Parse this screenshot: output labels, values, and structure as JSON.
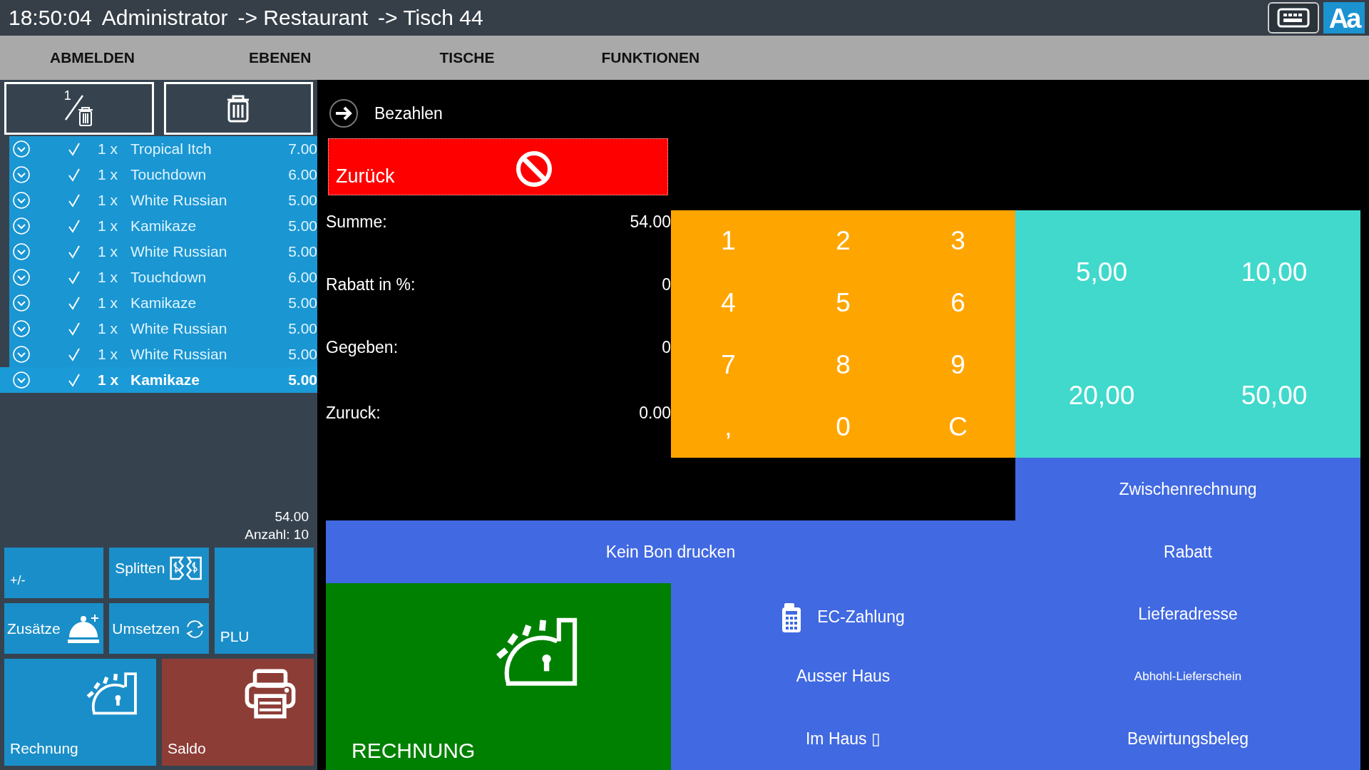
{
  "header": {
    "time": "18:50:04",
    "user": "Administrator",
    "path": [
      "-> Restaurant",
      "-> Tisch 44"
    ],
    "font_button": "Aa"
  },
  "menu": [
    {
      "label": "ABMELDEN"
    },
    {
      "label": "EBENEN"
    },
    {
      "label": "TISCHE"
    },
    {
      "label": "FUNKTIONEN"
    }
  ],
  "order": {
    "split_delete_label": "1",
    "items": [
      {
        "qty": "1 x",
        "name": "Tropical Itch",
        "price": "7.00",
        "checked": true,
        "selected": false
      },
      {
        "qty": "1 x",
        "name": "Touchdown",
        "price": "6.00",
        "checked": true,
        "selected": false
      },
      {
        "qty": "1 x",
        "name": "White Russian",
        "price": "5.00",
        "checked": true,
        "selected": false
      },
      {
        "qty": "1 x",
        "name": "Kamikaze",
        "price": "5.00",
        "checked": true,
        "selected": false
      },
      {
        "qty": "1 x",
        "name": "White Russian",
        "price": "5.00",
        "checked": true,
        "selected": false
      },
      {
        "qty": "1 x",
        "name": "Touchdown",
        "price": "6.00",
        "checked": true,
        "selected": false
      },
      {
        "qty": "1 x",
        "name": "Kamikaze",
        "price": "5.00",
        "checked": true,
        "selected": false
      },
      {
        "qty": "1 x",
        "name": "White Russian",
        "price": "5.00",
        "checked": true,
        "selected": false
      },
      {
        "qty": "1 x",
        "name": "White Russian",
        "price": "5.00",
        "checked": true,
        "selected": false
      },
      {
        "qty": "1 x",
        "name": "Kamikaze",
        "price": "5.00",
        "checked": true,
        "selected": true
      }
    ],
    "total": "54.00",
    "count_label": "Anzahl:",
    "count": "10"
  },
  "order_tiles": [
    {
      "label": "+/-",
      "kind": "plain"
    },
    {
      "label": "Splitten",
      "kind": "split"
    },
    {
      "label": "PLU",
      "kind": "tall"
    },
    {
      "label": "Zusätze",
      "kind": "bell"
    },
    {
      "label": "Umsetzen",
      "kind": "swap"
    },
    {
      "label": "Rechnung",
      "kind": "register"
    },
    {
      "label": "Saldo",
      "kind": "printer"
    }
  ],
  "payment": {
    "title": "Bezahlen",
    "cancel": "Zurück",
    "fields": [
      {
        "label": "Summe:",
        "value": "54.00"
      },
      {
        "label": "Rabatt in %:",
        "value": "0"
      },
      {
        "label": "Gegeben:",
        "value": "0"
      },
      {
        "label": "Zuruck:",
        "value": "0.00"
      }
    ],
    "keypad": [
      "1",
      "2",
      "3",
      "4",
      "5",
      "6",
      "7",
      "8",
      "9",
      ",",
      "0",
      "C"
    ],
    "quick_amounts": [
      "5,00",
      "10,00",
      "20,00",
      "50,00"
    ],
    "actions": [
      {
        "label": "Zwischenrechnung",
        "kind": "plain"
      },
      {
        "label": "Kein Bon drucken",
        "kind": "plain"
      },
      {
        "label": "Rabatt",
        "kind": "plain"
      },
      {
        "label": "RECHNUNG",
        "kind": "main"
      },
      {
        "label": "EC-Zahlung",
        "kind": "card"
      },
      {
        "label": "Lieferadresse",
        "kind": "plain"
      },
      {
        "label": "Ausser Haus",
        "kind": "plain"
      },
      {
        "label": "Abhohl-Lieferschein",
        "kind": "small"
      },
      {
        "label": "Im Haus ▯",
        "kind": "plain"
      },
      {
        "label": "Bewirtungsbeleg",
        "kind": "plain"
      }
    ]
  }
}
